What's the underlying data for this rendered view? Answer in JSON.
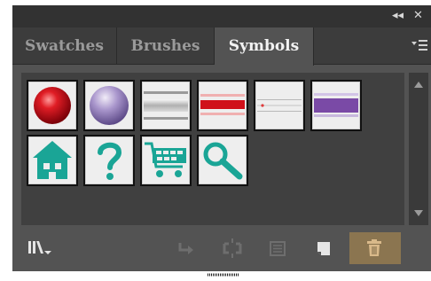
{
  "panel": {
    "collapse_icon": "double-chevron-left-icon",
    "close_icon": "close-icon",
    "collapse_glyph": "◂◂",
    "close_glyph": "✕"
  },
  "tabs": [
    {
      "label": "Swatches",
      "active": false
    },
    {
      "label": "Brushes",
      "active": false
    },
    {
      "label": "Symbols",
      "active": true
    }
  ],
  "panel_menu_icon": "panel-menu-icon",
  "symbols": [
    {
      "name": "red-sphere-symbol",
      "color": "#d0121a"
    },
    {
      "name": "purple-sphere-symbol",
      "color": "#9a86c0"
    },
    {
      "name": "silver-bar-symbol",
      "color": "#c8c8c8"
    },
    {
      "name": "red-bar-symbol",
      "color": "#d0101a"
    },
    {
      "name": "thin-red-line-symbol",
      "color": "#e03a3a"
    },
    {
      "name": "purple-bar-symbol",
      "color": "#7a4aa6"
    },
    {
      "name": "house-symbol",
      "color": "#1aa596"
    },
    {
      "name": "question-mark-symbol",
      "color": "#1aa596"
    },
    {
      "name": "shopping-cart-symbol",
      "color": "#1aa596"
    },
    {
      "name": "magnifier-symbol",
      "color": "#1aa596"
    }
  ],
  "footer": {
    "buttons": [
      "symbol-libraries-menu-icon",
      "place-symbol-instance-icon",
      "break-link-icon",
      "symbol-options-icon",
      "new-symbol-icon",
      "delete-symbol-icon"
    ],
    "delete_active_color": "#8b7550"
  },
  "colors": {
    "panel_bg": "#535353",
    "header_bg": "#323232",
    "tab_bg": "#3c3c3c",
    "accent_teal": "#1aa596"
  }
}
